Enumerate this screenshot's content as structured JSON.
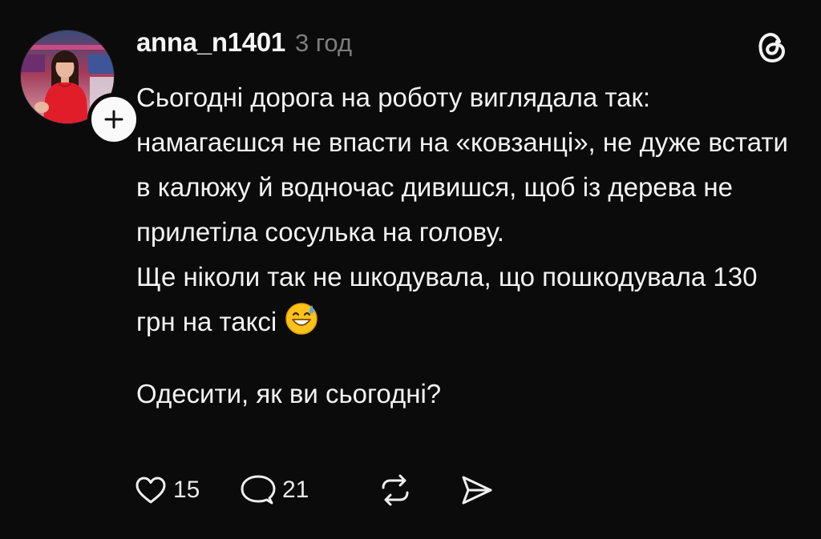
{
  "post": {
    "username": "anna_n1401",
    "time": "3 год",
    "paragraph_1": "Сьогодні дорога на роботу виглядала так: намагаєшся не впасти на «ковзанці», не дуже встати в калюжу й водночас дивишся, щоб із дерева не прилетіла сосулька на голову.",
    "paragraph_2": "Ще ніколи так не шкодувала, що пошкодувала 130 грн на таксі",
    "emoji": "grinning-face-with-sweat",
    "paragraph_3": "Одесити, як ви сьогодні?"
  },
  "actions": {
    "likes": "15",
    "replies": "21"
  },
  "icons": {
    "logo": "threads-logo-icon",
    "like": "heart-icon",
    "reply": "speech-bubble-icon",
    "repost": "repost-icon",
    "share": "send-icon",
    "follow": "plus-icon"
  },
  "colors": {
    "background": "#0b0b0b",
    "text": "#f3f3f3",
    "muted": "#7d7d7d"
  }
}
